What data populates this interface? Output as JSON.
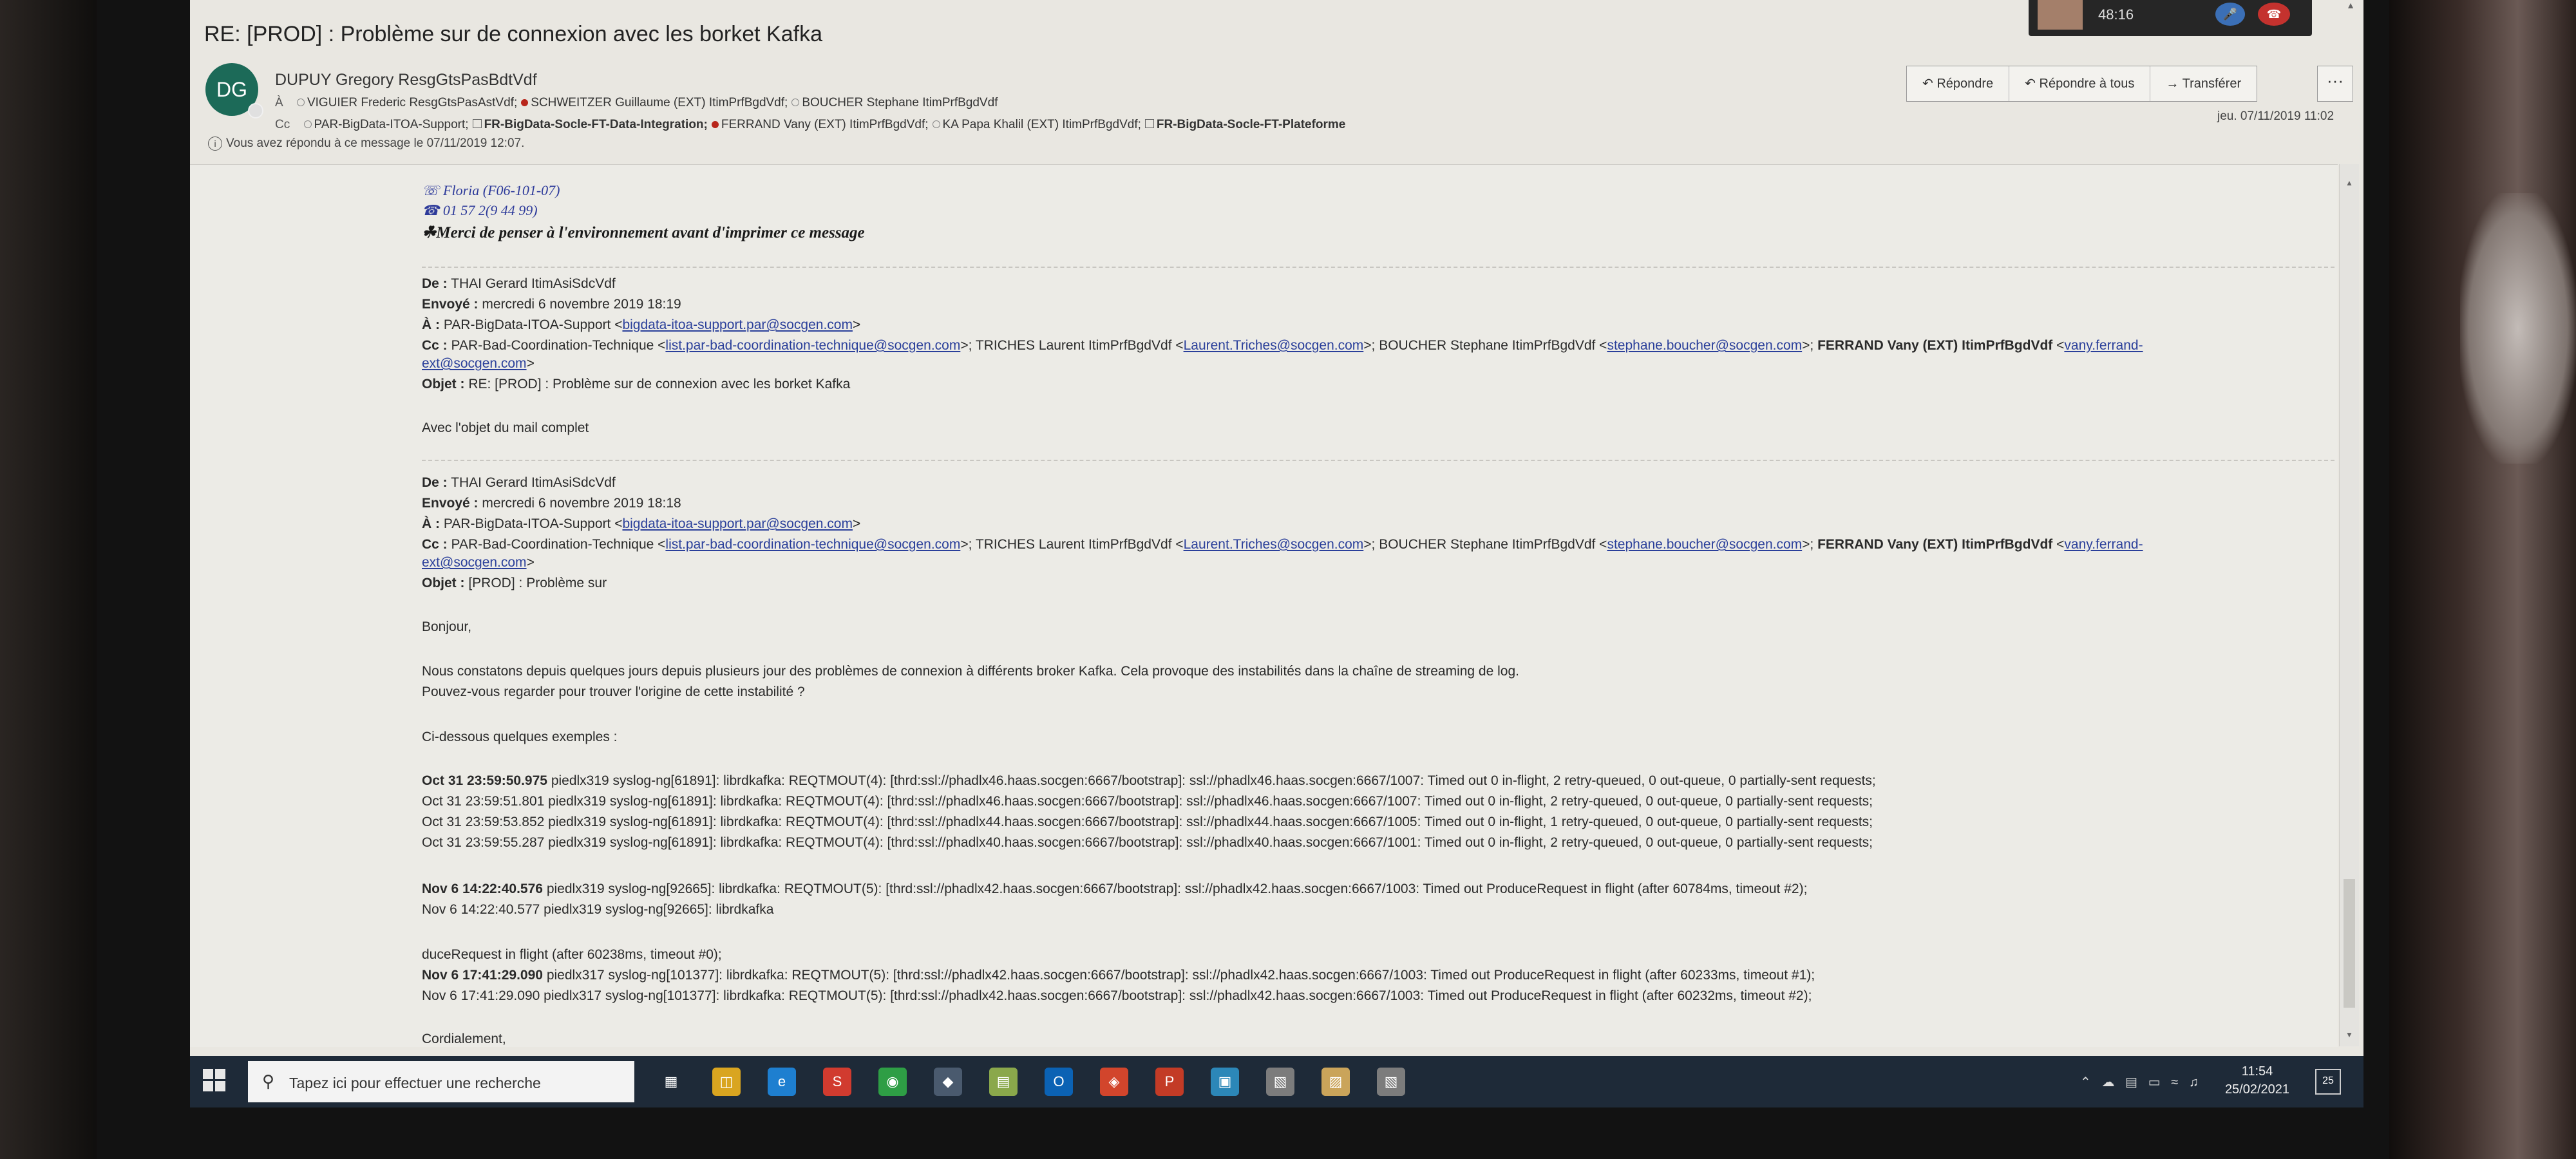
{
  "window": {
    "subject": "RE: [PROD] : Problème sur de connexion avec les borket Kafka",
    "call_time": "48:16"
  },
  "header": {
    "avatar_initials": "DG",
    "sender": "DUPUY Gregory ResgGtsPasBdtVdf",
    "to_label": "À",
    "to": [
      {
        "name": "VIGUIER Frederic ResgGtsPasAstVdf;",
        "status": "empty"
      },
      {
        "name": "SCHWEITZER Guillaume (EXT) ItimPrfBgdVdf;",
        "status": "red"
      },
      {
        "name": "BOUCHER Stephane ItimPrfBgdVdf",
        "status": "empty"
      }
    ],
    "cc_label": "Cc",
    "cc": [
      {
        "name": "PAR-BigData-ITOA-Support;",
        "status": "empty",
        "bold": false
      },
      {
        "name": "FR-BigData-Socle-FT-Data-Integration;",
        "status": "group",
        "bold": true
      },
      {
        "name": "FERRAND Vany (EXT) ItimPrfBgdVdf;",
        "status": "red",
        "bold": false
      },
      {
        "name": "KA Papa Khalil (EXT) ItimPrfBgdVdf;",
        "status": "empty",
        "bold": false
      },
      {
        "name": "FR-BigData-Socle-FT-Plateforme",
        "status": "group",
        "bold": true
      }
    ],
    "info": "Vous avez répondu à ce message le 07/11/2019 12:07.",
    "reply_label": "Répondre",
    "reply_all_label": "Répondre à tous",
    "forward_label": "Transférer",
    "more_label": "···",
    "date": "jeu. 07/11/2019 11:02"
  },
  "body": {
    "sig_floria": "Floria (F06-101-07)",
    "sig_phone": "01 57 2(9 44 99)",
    "sig_eco": "Merci de penser à l'environnement avant d'imprimer ce message",
    "msg1": {
      "from_label": "De :",
      "from": "THAI Gerard ItimAsiSdcVdf",
      "sent_label": "Envoyé :",
      "sent": "mercredi 6 novembre 2019 18:19",
      "to_label": "À :",
      "to": "PAR-BigData-ITOA-Support <",
      "to_link": "bigdata-itoa-support.par@socgen.com",
      "to_end": ">",
      "cc_label": "Cc :",
      "cc_a": "PAR-Bad-Coordination-Technique <",
      "cc_link1": "list.par-bad-coordination-technique@socgen.com",
      "cc_b": ">; TRICHES Laurent ItimPrfBgdVdf <",
      "cc_link2": "Laurent.Triches@socgen.com",
      "cc_c": ">; BOUCHER Stephane ItimPrfBgdVdf <",
      "cc_link3": "stephane.boucher@socgen.com",
      "cc_d": ">;",
      "cc_bold": "FERRAND Vany (EXT) ItimPrfBgdVdf",
      "cc_e": "<",
      "cc_link4a": "vany.ferrand-",
      "cc_link4b": "ext@socgen.com",
      "cc_f": ">",
      "subject_label": "Objet :",
      "subject": "RE: [PROD] : Problème sur de connexion avec les borket Kafka",
      "text": "Avec l'objet du mail complet"
    },
    "msg2": {
      "from_label": "De :",
      "from": "THAI Gerard ItimAsiSdcVdf",
      "sent_label": "Envoyé :",
      "sent": "mercredi 6 novembre 2019 18:18",
      "to_label": "À :",
      "to": "PAR-BigData-ITOA-Support <",
      "to_link": "bigdata-itoa-support.par@socgen.com",
      "to_end": ">",
      "cc_label": "Cc :",
      "cc_a": "PAR-Bad-Coordination-Technique <",
      "cc_link1": "list.par-bad-coordination-technique@socgen.com",
      "cc_b": ">; TRICHES Laurent ItimPrfBgdVdf <",
      "cc_link2": "Laurent.Triches@socgen.com",
      "cc_c": ">; BOUCHER Stephane ItimPrfBgdVdf <",
      "cc_link3": "stephane.boucher@socgen.com",
      "cc_d": ">;",
      "cc_bold": "FERRAND Vany (EXT) ItimPrfBgdVdf",
      "cc_e": "<",
      "cc_link4a": "vany.ferrand-",
      "cc_link4b": "ext@socgen.com",
      "cc_f": ">",
      "subject_label": "Objet :",
      "subject": "[PROD] : Problème sur",
      "greeting": "Bonjour,",
      "p1": "Nous constatons depuis quelques jours depuis plusieurs jour des problèmes de connexion à différents broker Kafka. Cela provoque des instabilités dans la chaîne de streaming de log.",
      "p2": "Pouvez-vous regarder pour trouver l'origine de cette instabilité ?",
      "examples": "Ci-dessous quelques exemples :",
      "logs1": [
        {
          "ts": "Oct 31 23:59:50.975",
          "rest": "piedlx319 syslog-ng[61891]: librdkafka: REQTMOUT(4): [thrd:ssl://phadlx46.haas.socgen:6667/bootstrap]: ssl://phadlx46.haas.socgen:6667/1007: Timed out 0 in-flight, 2 retry-queued, 0 out-queue, 0 partially-sent requests;",
          "bold": true
        },
        {
          "ts": "Oct 31 23:59:51.801",
          "rest": "piedlx319 syslog-ng[61891]: librdkafka: REQTMOUT(4): [thrd:ssl://phadlx46.haas.socgen:6667/bootstrap]: ssl://phadlx46.haas.socgen:6667/1007: Timed out 0 in-flight, 2 retry-queued, 0 out-queue, 0 partially-sent requests;",
          "bold": false
        },
        {
          "ts": "Oct 31 23:59:53.852",
          "rest": "piedlx319 syslog-ng[61891]: librdkafka: REQTMOUT(4): [thrd:ssl://phadlx44.haas.socgen:6667/bootstrap]: ssl://phadlx44.haas.socgen:6667/1005: Timed out 0 in-flight, 1 retry-queued, 0 out-queue, 0 partially-sent requests;",
          "bold": false
        },
        {
          "ts": "Oct 31 23:59:55.287",
          "rest": "piedlx319 syslog-ng[61891]: librdkafka: REQTMOUT(4): [thrd:ssl://phadlx40.haas.socgen:6667/bootstrap]: ssl://phadlx40.haas.socgen:6667/1001: Timed out 0 in-flight, 2 retry-queued, 0 out-queue, 0 partially-sent requests;",
          "bold": false
        }
      ],
      "logs2": [
        {
          "ts": "Nov  6 14:22:40.576",
          "rest": "piedlx319 syslog-ng[92665]: librdkafka: REQTMOUT(5): [thrd:ssl://phadlx42.haas.socgen:6667/bootstrap]: ssl://phadlx42.haas.socgen:6667/1003: Timed out ProduceRequest in flight (after 60784ms, timeout #2);",
          "bold": true
        },
        {
          "ts": "Nov  6 14:22:40.577",
          "rest": "piedlx319 syslog-ng[92665]: librdkafka",
          "bold": false
        }
      ],
      "logs3_first": "duceRequest in flight (after 60238ms, timeout #0);",
      "logs3": [
        {
          "ts": "Nov  6 17:41:29.090",
          "rest": "piedlx317 syslog-ng[101377]: librdkafka: REQTMOUT(5): [thrd:ssl://phadlx42.haas.socgen:6667/bootstrap]: ssl://phadlx42.haas.socgen:6667/1003: Timed out ProduceRequest in flight (after 60233ms, timeout #1);",
          "bold": true
        },
        {
          "ts": "Nov  6 17:41:29.090",
          "rest": "piedlx317 syslog-ng[101377]: librdkafka: REQTMOUT(5): [thrd:ssl://phadlx42.haas.socgen:6667/bootstrap]: ssl://phadlx42.haas.socgen:6667/1003: Timed out ProduceRequest in flight (after 60232ms, timeout #2);",
          "bold": false
        }
      ],
      "closing": "Cordialement,"
    }
  },
  "taskbar": {
    "search_placeholder": "Tapez ici pour effectuer une recherche",
    "time": "11:54",
    "date": "25/02/2021",
    "notif_count": "25",
    "icons": [
      "task-view-icon",
      "file-explorer-icon",
      "edge-icon",
      "skype-icon",
      "chrome-icon",
      "keepass-icon",
      "notepad-icon",
      "outlook-icon",
      "git-icon",
      "powerpoint-icon",
      "remote-desktop-icon",
      "app-icon-1",
      "app-icon-2",
      "app-icon-3"
    ]
  }
}
